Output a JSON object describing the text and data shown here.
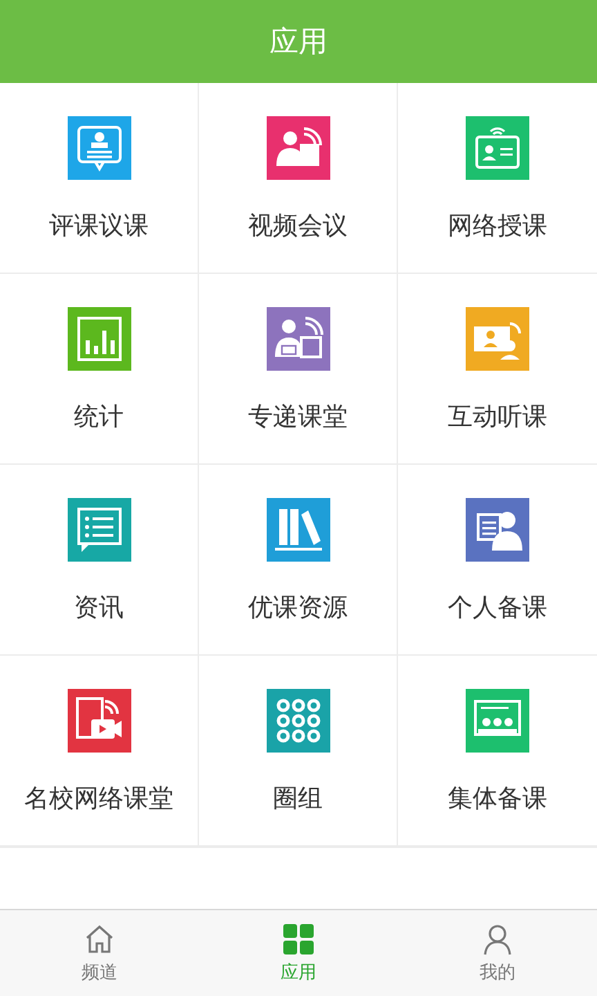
{
  "header": {
    "title": "应用"
  },
  "apps": [
    {
      "label": "评课议课",
      "kind": "review",
      "color": "#1ea6e8"
    },
    {
      "label": "视频会议",
      "kind": "meeting",
      "color": "#e8306e"
    },
    {
      "label": "网络授课",
      "kind": "badge",
      "color": "#1dbf6e"
    },
    {
      "label": "统计",
      "kind": "stats",
      "color": "#5cb81e"
    },
    {
      "label": "专递课堂",
      "kind": "teacher",
      "color": "#8d73bd"
    },
    {
      "label": "互动听课",
      "kind": "screen",
      "color": "#f0aa22"
    },
    {
      "label": "资讯",
      "kind": "news",
      "color": "#17a8a5"
    },
    {
      "label": "优课资源",
      "kind": "books",
      "color": "#1f9ed8"
    },
    {
      "label": "个人备课",
      "kind": "planner",
      "color": "#5a72c0"
    },
    {
      "label": "名校网络课堂",
      "kind": "video",
      "color": "#e23441"
    },
    {
      "label": "圈组",
      "kind": "dots",
      "color": "#1aa3a8"
    },
    {
      "label": "集体备课",
      "kind": "group",
      "color": "#1dbf6e"
    }
  ],
  "tabs": [
    {
      "label": "频道",
      "kind": "home",
      "selected": false
    },
    {
      "label": "应用",
      "kind": "apps",
      "selected": true
    },
    {
      "label": "我的",
      "kind": "me",
      "selected": false
    }
  ]
}
